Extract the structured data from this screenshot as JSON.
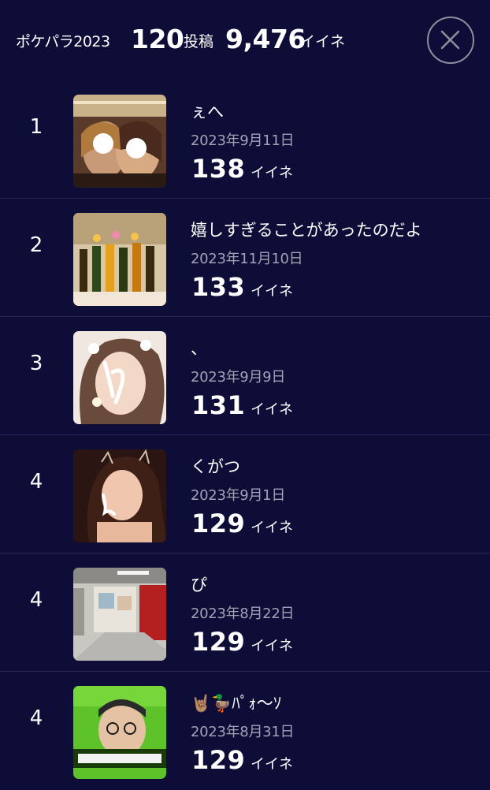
{
  "header": {
    "app_label": "ポケパラ2023",
    "posts_count": "120",
    "posts_unit": "投稿",
    "likes_total": "9,476",
    "likes_unit": "イイネ"
  },
  "ranking": [
    {
      "rank": "1",
      "title": "ぇへ",
      "date": "2023年9月11日",
      "likes": "138",
      "likes_unit": "イイネ"
    },
    {
      "rank": "2",
      "title": "嬉しすぎることがあったのだよ",
      "date": "2023年11月10日",
      "likes": "133",
      "likes_unit": "イイネ"
    },
    {
      "rank": "3",
      "title": "、",
      "date": "2023年9月9日",
      "likes": "131",
      "likes_unit": "イイネ"
    },
    {
      "rank": "4",
      "title": "くがつ",
      "date": "2023年9月1日",
      "likes": "129",
      "likes_unit": "イイネ"
    },
    {
      "rank": "4",
      "title": "ぴ",
      "date": "2023年8月22日",
      "likes": "129",
      "likes_unit": "イイネ"
    },
    {
      "rank": "4",
      "title": "🤘🏽🦆ﾊﾟｫ〜ｿ",
      "date": "2023年8月31日",
      "likes": "129",
      "likes_unit": "イイネ"
    }
  ],
  "colors": {
    "background": "#0d0d38",
    "divider": "#27275a",
    "date_text": "#a2a2b4",
    "close_ring": "#8f8f9c"
  },
  "icons": {
    "close": "close-x-icon"
  }
}
